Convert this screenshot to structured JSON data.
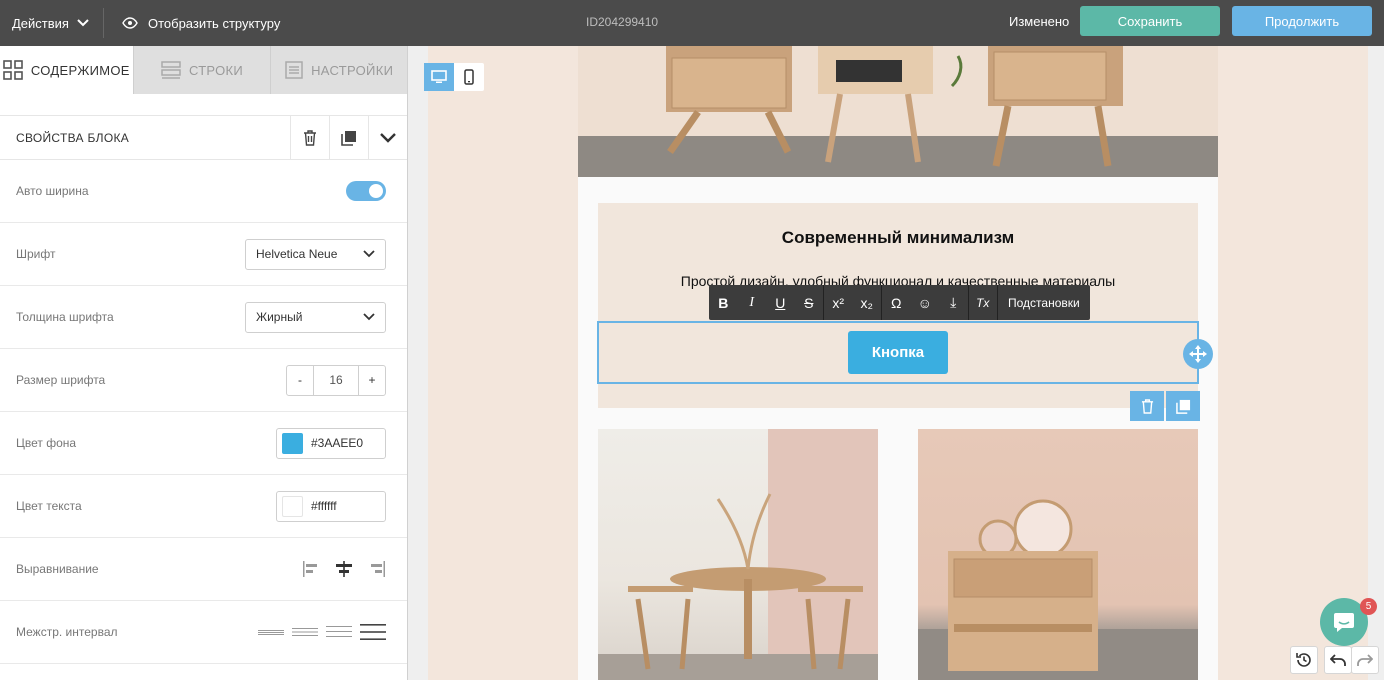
{
  "topbar": {
    "actions_label": "Действия",
    "structure_label": "Отобразить структуру",
    "id_label": "ID204299410",
    "changed_label": "Изменено",
    "save_label": "Сохранить",
    "continue_label": "Продолжить"
  },
  "tabs": [
    {
      "label": "СОДЕРЖИМОЕ",
      "icon": "grid-icon",
      "active": true
    },
    {
      "label": "СТРОКИ",
      "icon": "rows-icon",
      "active": false
    },
    {
      "label": "НАСТРОЙКИ",
      "icon": "settings-icon",
      "active": false
    }
  ],
  "block": {
    "title": "СВОЙСТВА БЛОКА",
    "actions": [
      "trash-icon",
      "duplicate-icon",
      "chevron-down-icon"
    ]
  },
  "props": {
    "auto_width": {
      "label": "Авто ширина",
      "enabled": true
    },
    "font": {
      "label": "Шрифт",
      "value": "Helvetica Neue"
    },
    "font_weight": {
      "label": "Толщина шрифта",
      "value": "Жирный"
    },
    "font_size": {
      "label": "Размер шрифта",
      "value": "16",
      "minus": "-",
      "plus": "+"
    },
    "bg_color": {
      "label": "Цвет фона",
      "value": "#3AAEE0",
      "swatch": "#3AAEE0"
    },
    "text_color": {
      "label": "Цвет текста",
      "value": "#ffffff",
      "swatch": "#ffffff"
    },
    "align": {
      "label": "Выравнивание",
      "options": [
        "align-left-icon",
        "align-center-icon",
        "align-right-icon"
      ]
    },
    "line_height": {
      "label": "Межстр. интервал",
      "options": [
        "line-height-1-icon",
        "line-height-2-icon",
        "line-height-3-icon",
        "line-height-4-icon"
      ]
    }
  },
  "canvas": {
    "device_options": [
      "desktop-icon",
      "mobile-icon"
    ],
    "heading": "Современный минимализм",
    "subtitle": "Простой дизайн, удобный функционал и качественные материалы",
    "button_label": "Кнопка",
    "toolbar": {
      "buttons": [
        "B",
        "I",
        "U",
        "S",
        "x²",
        "x₂",
        "Ω",
        "☺",
        "⤓",
        "Tx"
      ],
      "substitutions_label": "Подстановки"
    }
  },
  "chat": {
    "badge": "5"
  },
  "colors": {
    "topbar": "#4b4b4b",
    "save": "#5cb8a7",
    "continue": "#69b4e5",
    "accent": "#69b4e5",
    "cta": "#3aaee0"
  }
}
